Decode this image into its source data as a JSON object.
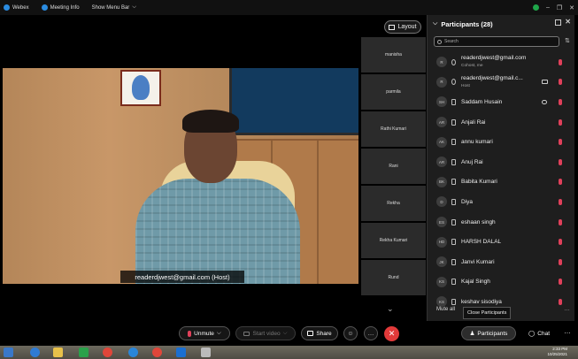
{
  "titlebar": {
    "app_name": "Webex",
    "meeting_info": "Meeting Info",
    "show_menu_bar": "Show Menu Bar"
  },
  "stage": {
    "layout_label": "Layout",
    "main_video_label": "readerdjwest@gmail.com (Host)",
    "tiles": [
      "manisha",
      "parmila",
      "Rathi Kumari",
      "Rani",
      "Rekha",
      "Rekha Kumari",
      "Rund"
    ]
  },
  "participants_panel": {
    "title": "Participants (28)",
    "search_placeholder": "Search",
    "rows": [
      {
        "initials": "R",
        "name": "readerdjwest@gmail.com",
        "sub": "Cohost, me"
      },
      {
        "initials": "R",
        "name": "readerdjwest@gmail.c...",
        "sub": "Host"
      },
      {
        "initials": "SH",
        "name": "Saddam Husain",
        "sub": ""
      },
      {
        "initials": "AR",
        "name": "Anjali Rai",
        "sub": ""
      },
      {
        "initials": "AK",
        "name": "annu kumari",
        "sub": ""
      },
      {
        "initials": "AR",
        "name": "Anuj Rai",
        "sub": ""
      },
      {
        "initials": "BK",
        "name": "Babita Kumari",
        "sub": ""
      },
      {
        "initials": "D",
        "name": "Diya",
        "sub": ""
      },
      {
        "initials": "ES",
        "name": "eshaan singh",
        "sub": ""
      },
      {
        "initials": "HD",
        "name": "HARSH DALAL",
        "sub": ""
      },
      {
        "initials": "JK",
        "name": "Janvi Kumari",
        "sub": ""
      },
      {
        "initials": "KS",
        "name": "Kajal Singh",
        "sub": ""
      },
      {
        "initials": "KS",
        "name": "keshav sisodiya",
        "sub": ""
      }
    ],
    "mute_all": "Mute all",
    "close_participants": "Close Participants"
  },
  "controls": {
    "unmute": "Unmute",
    "start_video": "Start video",
    "share": "Share",
    "participants": "Participants",
    "chat": "Chat"
  },
  "taskbar": {
    "time": "2:33 PM",
    "date": "10/25/2021"
  },
  "colors": {
    "end_call": "#e23a3a",
    "muted_mic": "#e0405a",
    "panel_bg": "#1e1e1e"
  }
}
